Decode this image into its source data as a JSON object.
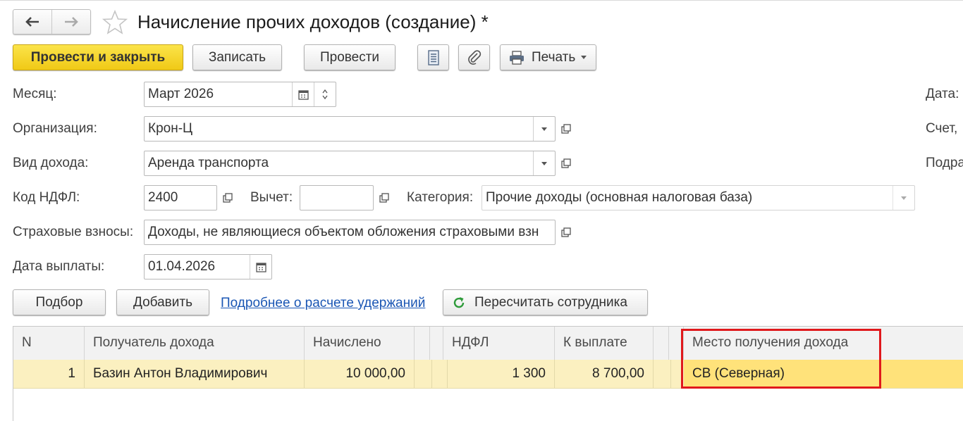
{
  "window": {
    "title": "Начисление прочих доходов (создание) *"
  },
  "nav": {
    "back_icon": "arrow-left-icon",
    "forward_icon": "arrow-right-icon",
    "favorite_icon": "star-icon"
  },
  "toolbar": {
    "post_close_label": "Провести и закрыть",
    "save_label": "Записать",
    "post_label": "Провести",
    "print_label": "Печать"
  },
  "form": {
    "month_label": "Месяц:",
    "month_value": "Март 2026",
    "org_label": "Организация:",
    "org_value": "Крон-Ц",
    "income_type_label": "Вид дохода:",
    "income_type_value": "Аренда транспорта",
    "ndfl_code_label": "Код НДФЛ:",
    "ndfl_code_value": "2400",
    "deduction_label": "Вычет:",
    "deduction_value": "",
    "category_label": "Категория:",
    "category_value": "Прочие доходы (основная налоговая база)",
    "insurance_label": "Страховые взносы:",
    "insurance_value": "Доходы, не являющиеся объектом обложения страховыми взн",
    "payment_date_label": "Дата выплаты:",
    "payment_date_value": "01.04.2026",
    "right_date_label": "Дата:",
    "right_account_label": "Счет,",
    "right_dept_label": "Подра"
  },
  "table_toolbar": {
    "pick_label": "Подбор",
    "add_label": "Добавить",
    "details_link": "Подробнее о расчете удержаний",
    "recalc_label": "Пересчитать сотрудника"
  },
  "table": {
    "headers": {
      "n": "N",
      "recipient": "Получатель дохода",
      "accrued": "Начислено",
      "ndfl": "НДФЛ",
      "payout": "К выплате",
      "place": "Место получения дохода"
    },
    "rows": [
      {
        "n": "1",
        "recipient": "Базин Антон Владимирович",
        "accrued": "10 000,00",
        "ndfl": "1 300",
        "payout": "8 700,00",
        "place": "СВ (Северная)"
      }
    ]
  },
  "colors": {
    "primary": "#f5d22b",
    "highlight_border": "#e0191c",
    "selected_row": "#fbf0c0",
    "link": "#1a56b4"
  }
}
